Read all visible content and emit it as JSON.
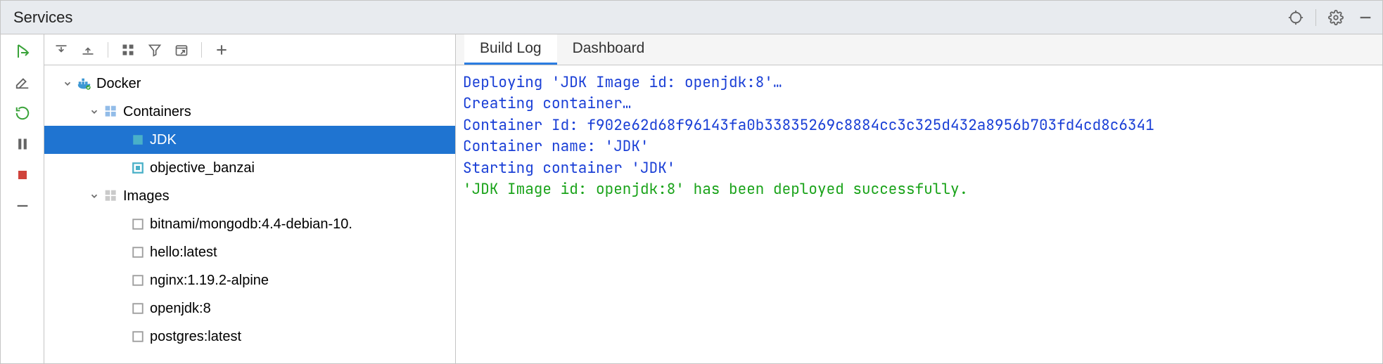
{
  "panel": {
    "title": "Services"
  },
  "tree": {
    "docker": {
      "label": "Docker"
    },
    "containers_group": {
      "label": "Containers"
    },
    "containers": [
      {
        "label": "JDK"
      },
      {
        "label": "objective_banzai"
      }
    ],
    "images_group": {
      "label": "Images"
    },
    "images": [
      {
        "label": "bitnami/mongodb:4.4-debian-10."
      },
      {
        "label": "hello:latest"
      },
      {
        "label": "nginx:1.19.2-alpine"
      },
      {
        "label": "openjdk:8"
      },
      {
        "label": "postgres:latest"
      }
    ]
  },
  "tabs": [
    {
      "label": "Build Log",
      "active": true
    },
    {
      "label": "Dashboard",
      "active": false
    }
  ],
  "log": {
    "lines": [
      {
        "cls": "blue",
        "text": "Deploying 'JDK Image id: openjdk:8'…"
      },
      {
        "cls": "blue",
        "text": "Creating container…"
      },
      {
        "cls": "blue",
        "text": "Container Id: f902e62d68f96143fa0b33835269c8884cc3c325d432a8956b703fd4cd8c6341"
      },
      {
        "cls": "blue",
        "text": "Container name: 'JDK'"
      },
      {
        "cls": "blue",
        "text": "Starting container 'JDK'"
      },
      {
        "cls": "green",
        "text": "'JDK Image id: openjdk:8' has been deployed successfully."
      }
    ]
  }
}
